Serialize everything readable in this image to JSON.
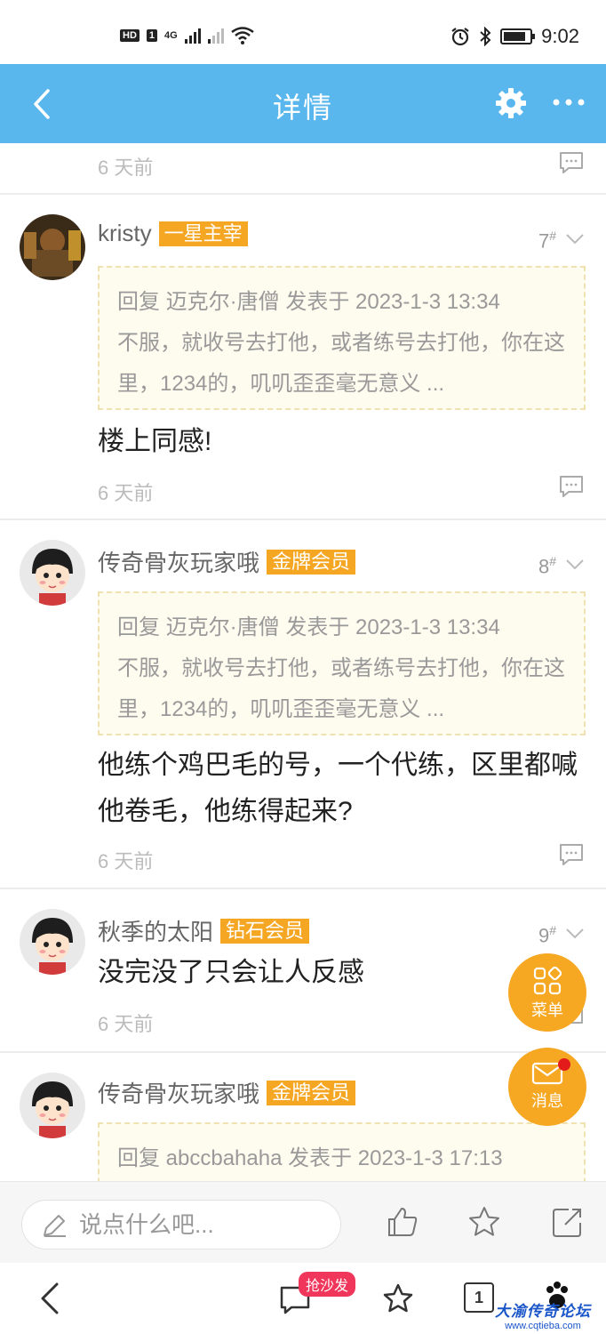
{
  "status_bar": {
    "left_badge": "HD",
    "network": "4G",
    "time": "9:02"
  },
  "header": {
    "title": "详情"
  },
  "first_post_time": "6 天前",
  "posts": [
    {
      "name": "kristy",
      "badge": "一星主宰",
      "floor": "7",
      "quote_head": "回复 迈克尔·唐僧 发表于 2023-1-3 13:34",
      "quote_body": "不服，就收号去打他，或者练号去打他，你在这里，1234的，叽叽歪歪毫无意义 ...",
      "text": "楼上同感!",
      "time": "6 天前"
    },
    {
      "name": "传奇骨灰玩家哦",
      "badge": "金牌会员",
      "floor": "8",
      "quote_head": "回复 迈克尔·唐僧 发表于 2023-1-3 13:34",
      "quote_body": "不服，就收号去打他，或者练号去打他，你在这里，1234的，叽叽歪歪毫无意义 ...",
      "text": "他练个鸡巴毛的号，一个代练，区里都喊他卷毛，他练得起来?",
      "time": "6 天前"
    },
    {
      "name": "秋季的太阳",
      "badge": "钻石会员",
      "floor": "9",
      "text": "没完没了只会让人反感",
      "time": "6 天前"
    },
    {
      "name": "传奇骨灰玩家哦",
      "badge": "金牌会员",
      "quote_head": "回复 abccbahaha 发表于 2023-1-3 17:13"
    }
  ],
  "floor_mark": "#",
  "fab": {
    "menu": "菜单",
    "messages": "消息"
  },
  "comment_bar": {
    "placeholder": "说点什么吧..."
  },
  "bottom_nav": {
    "sofa_label": "抢沙发",
    "tab_count": "1"
  },
  "watermark": {
    "title": "大渝传奇论坛",
    "url": "www.cqtieba.com"
  },
  "colors": {
    "header": "#59b7ee",
    "badge": "#f5a623",
    "fab": "#f7a823",
    "sofa": "#f0365a"
  }
}
